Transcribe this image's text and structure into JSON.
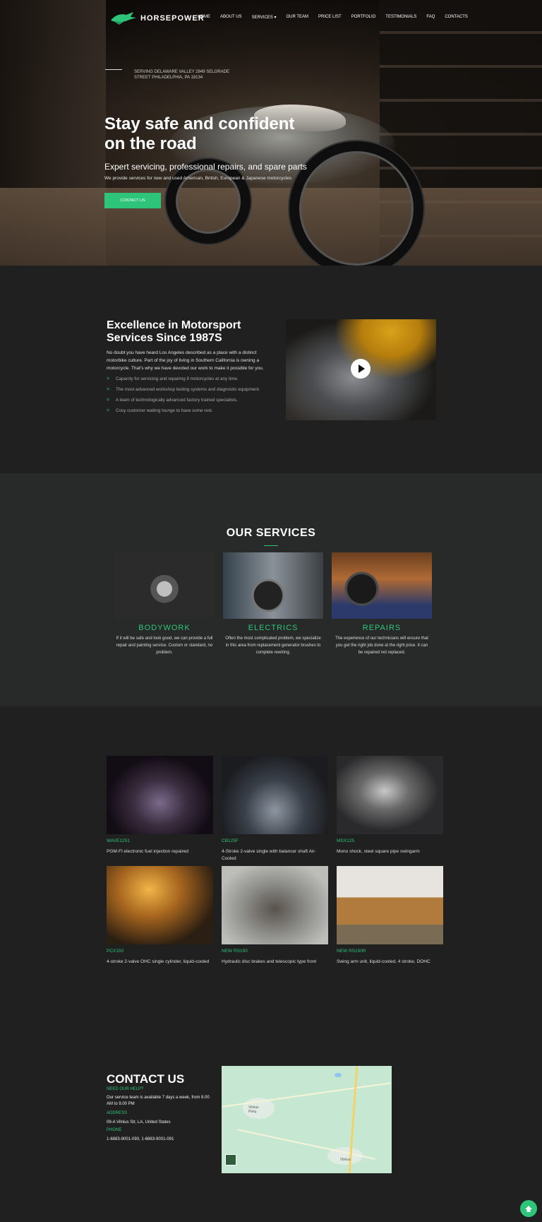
{
  "brand": {
    "name": "HORSEPOWER",
    "accent": "#2ec57a"
  },
  "nav": {
    "items": [
      "HOME",
      "ABOUT US",
      "SERVICES ▾",
      "OUR TEAM",
      "PRICE LIST",
      "PORTFOLIO",
      "TESTIMONIALS",
      "FAQ",
      "CONTACTS"
    ]
  },
  "hero": {
    "address": "SERVING DELAWARE VALLEY 2849 SELGRADE STREET PHILADELPHIA, PA 19134",
    "title": "Stay safe and confident on the road",
    "subtitle": "Expert servicing, professional repairs, and spare parts",
    "description": "We provide services for new and used American, British, European & Japanese motorcycles",
    "cta": "CONTACT US"
  },
  "about": {
    "title": "Excellence in Motorsport Services Since 1987S",
    "text": "No doubt you have heard Los Angeles described as a place with a distinct motorbike culture. Part of the joy of living in Southern California is owning a motorcycle. That’s why we have devoted our work to make it possible for you.",
    "bullets": [
      "Capacity for servicing and repairing 8 motorcycles at any time.",
      "The most advanced workshop testing systems and diagnostic equipment.",
      "A team of technologically advanced factory trained specialists.",
      "Cosy customer waiting lounge to have some rest."
    ],
    "video_icon": "play-icon"
  },
  "services": {
    "title": "OUR SERVICES",
    "items": [
      {
        "name": "BODYWORK",
        "text": "If it will be safe and look good, we can provide a full repair and painting service. Custom or standard, no problem."
      },
      {
        "name": "ELECTRICS",
        "text": "Often the most complicated problem, we specialize in this area from replacement generator brushes to complete rewiring."
      },
      {
        "name": "REPAIRS",
        "text": "The experience of our technicians will ensure that you get the right job done at the right price. It can be repaired not replaced."
      }
    ]
  },
  "portfolio": {
    "items": [
      {
        "name": "WAVE1251",
        "desc": "PGM-FI electronic fuel injection repaired"
      },
      {
        "name": "CB125F",
        "desc": "4-Stroke 2-valve single with balancer shaft Air-Cooled"
      },
      {
        "name": "MSX125",
        "desc": "Mono shock, steel square pipe swingarm"
      },
      {
        "name": "PCX150",
        "desc": "4-stroke 2-valve OHC single cylinder, liquid-cooled"
      },
      {
        "name": "NEW RS150",
        "desc": "Hydraulic disc brakes and telescopic type front"
      },
      {
        "name": "NEW RS150R",
        "desc": "Swing arm unit, liquid-cooled, 4 stroke, DOHC"
      }
    ]
  },
  "contact": {
    "title": "CONTACT US",
    "help_label": "NEED OUR HELP?",
    "help_text": "Our service team is available 7 days a week, from 8.00 AM to 9.00 PM",
    "address_label": "ADDRESS",
    "address": "09-A Vilnius Str, LA, United States",
    "phone_label": "PHONE",
    "phone": "1-6883-9001-090, 1-6883-9001-091",
    "map_towns": [
      "Vilnius",
      "Pietų",
      "Vilnius"
    ]
  },
  "back_to_top_icon": "arrow-up-icon"
}
